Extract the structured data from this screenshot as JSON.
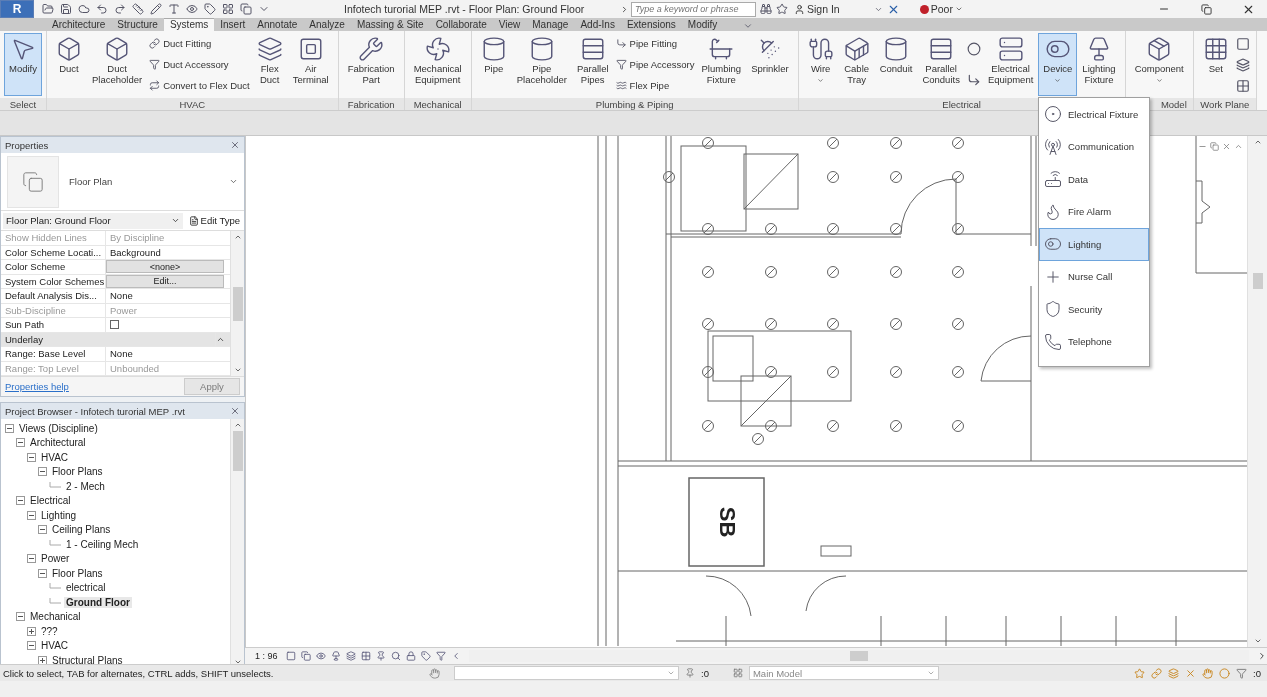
{
  "app_button": {
    "letter": "R"
  },
  "title": "Infotech turorial  MEP .rvt - Floor Plan: Ground Floor",
  "search": {
    "placeholder": "Type a keyword or phrase"
  },
  "sign_in": "Sign In",
  "connection": "Poor",
  "tabs": [
    {
      "label": "Architecture",
      "selected": false
    },
    {
      "label": "Structure",
      "selected": false
    },
    {
      "label": "Systems",
      "selected": true
    },
    {
      "label": "Insert",
      "selected": false
    },
    {
      "label": "Annotate",
      "selected": false
    },
    {
      "label": "Analyze",
      "selected": false
    },
    {
      "label": "Massing & Site",
      "selected": false
    },
    {
      "label": "Collaborate",
      "selected": false
    },
    {
      "label": "View",
      "selected": false
    },
    {
      "label": "Manage",
      "selected": false
    },
    {
      "label": "Add-Ins",
      "selected": false
    },
    {
      "label": "Extensions",
      "selected": false
    },
    {
      "label": "Modify",
      "selected": false
    }
  ],
  "ribbon": [
    {
      "label": "Select",
      "items": [
        {
          "kind": "large",
          "label": "Modify",
          "selected": true,
          "menu": false
        }
      ]
    },
    {
      "label": "HVAC",
      "items": [
        {
          "kind": "large",
          "label": "Duct",
          "selected": false,
          "menu": false
        },
        {
          "kind": "large",
          "label": "Duct\nPlaceholder",
          "selected": false,
          "menu": false
        },
        {
          "kind": "stack",
          "items": [
            "Duct Fitting",
            "Duct Accessory",
            "Convert to Flex Duct"
          ]
        },
        {
          "kind": "large",
          "label": "Flex\nDuct",
          "selected": false,
          "menu": false
        },
        {
          "kind": "large",
          "label": "Air\nTerminal",
          "selected": false,
          "menu": false
        }
      ]
    },
    {
      "label": "Fabrication",
      "items": [
        {
          "kind": "large",
          "label": "Fabrication\nPart",
          "selected": false,
          "menu": false
        }
      ]
    },
    {
      "label": "Mechanical",
      "items": [
        {
          "kind": "large",
          "label": "Mechanical\nEquipment",
          "selected": false,
          "menu": false
        }
      ]
    },
    {
      "label": "Plumbing & Piping",
      "items": [
        {
          "kind": "large",
          "label": "Pipe",
          "selected": false,
          "menu": false
        },
        {
          "kind": "large",
          "label": "Pipe\nPlaceholder",
          "selected": false,
          "menu": false
        },
        {
          "kind": "large",
          "label": "Parallel\nPipes",
          "selected": false,
          "menu": false
        },
        {
          "kind": "stack",
          "items": [
            "Pipe Fitting",
            "Pipe Accessory",
            "Flex Pipe"
          ]
        },
        {
          "kind": "large",
          "label": "Plumbing\nFixture",
          "selected": false,
          "menu": false
        },
        {
          "kind": "large",
          "label": "Sprinkler",
          "selected": false,
          "menu": false
        }
      ]
    },
    {
      "label": "Electrical",
      "items": [
        {
          "kind": "large",
          "label": "Wire",
          "selected": false,
          "menu": true
        },
        {
          "kind": "large",
          "label": "Cable\nTray",
          "selected": false,
          "menu": false
        },
        {
          "kind": "large",
          "label": "Conduit",
          "selected": false,
          "menu": false
        },
        {
          "kind": "large",
          "label": "Parallel\nConduits",
          "selected": false,
          "menu": false
        },
        {
          "kind": "icons"
        },
        {
          "kind": "large",
          "label": "Electrical\nEquipment",
          "selected": false,
          "menu": false
        },
        {
          "kind": "large",
          "label": "Device",
          "selected": true,
          "menu": true
        },
        {
          "kind": "large",
          "label": "Lighting\nFixture",
          "selected": false,
          "menu": false
        }
      ]
    },
    {
      "label": "Model",
      "items": [
        {
          "kind": "large",
          "label": "Component",
          "selected": false,
          "menu": true
        }
      ]
    },
    {
      "label": "Work Plane",
      "items": [
        {
          "kind": "large",
          "label": "Set",
          "selected": false,
          "menu": false
        },
        {
          "kind": "icons"
        }
      ]
    }
  ],
  "device_menu": [
    {
      "label": "Electrical Fixture",
      "selected": false
    },
    {
      "label": "Communication",
      "selected": false
    },
    {
      "label": "Data",
      "selected": false
    },
    {
      "label": "Fire Alarm",
      "selected": false
    },
    {
      "label": "Lighting",
      "selected": true
    },
    {
      "label": "Nurse Call",
      "selected": false
    },
    {
      "label": "Security",
      "selected": false
    },
    {
      "label": "Telephone",
      "selected": false
    }
  ],
  "properties": {
    "title": "Properties",
    "type_name": "Floor Plan",
    "instance": "Floor Plan: Ground Floor",
    "edit_type": "Edit Type",
    "rows": [
      {
        "kind": "text",
        "name": "Show Hidden Lines",
        "value": "By Discipline",
        "disabled": true
      },
      {
        "kind": "text",
        "name": "Color Scheme Locati...",
        "value": "Background",
        "disabled": false
      },
      {
        "kind": "button",
        "name": "Color Scheme",
        "value": "<none>",
        "disabled": false
      },
      {
        "kind": "button",
        "name": "System Color Schemes",
        "value": "Edit...",
        "disabled": false
      },
      {
        "kind": "text",
        "name": "Default Analysis Dis...",
        "value": "None",
        "disabled": false
      },
      {
        "kind": "text",
        "name": "Sub-Discipline",
        "value": "Power",
        "disabled": true
      },
      {
        "kind": "checkbox",
        "name": "Sun Path",
        "checked": false,
        "disabled": false
      },
      {
        "kind": "group",
        "name": "Underlay",
        "expanded": true
      },
      {
        "kind": "text",
        "name": "Range: Base Level",
        "value": "None",
        "disabled": false
      },
      {
        "kind": "text",
        "name": "Range: Top Level",
        "value": "Unbounded",
        "disabled": true
      }
    ],
    "help": "Properties help",
    "apply": {
      "label": "Apply",
      "disabled": true
    }
  },
  "project_browser": {
    "title": "Project Browser - Infotech turorial  MEP .rvt",
    "tree": [
      {
        "label": "Views (Discipline)",
        "expanded": true,
        "selected": false,
        "children": [
          {
            "label": "Architectural",
            "expanded": true,
            "selected": false,
            "children": [
              {
                "label": "HVAC",
                "expanded": true,
                "selected": false,
                "children": [
                  {
                    "label": "Floor Plans",
                    "expanded": true,
                    "selected": false,
                    "children": [
                      {
                        "label": "2 - Mech",
                        "selected": false
                      }
                    ]
                  }
                ]
              }
            ]
          },
          {
            "label": "Electrical",
            "expanded": true,
            "selected": false,
            "children": [
              {
                "label": "Lighting",
                "expanded": true,
                "selected": false,
                "children": [
                  {
                    "label": "Ceiling Plans",
                    "expanded": true,
                    "selected": false,
                    "children": [
                      {
                        "label": "1 - Ceiling Mech",
                        "selected": false
                      }
                    ]
                  }
                ]
              },
              {
                "label": "Power",
                "expanded": true,
                "selected": false,
                "children": [
                  {
                    "label": "Floor Plans",
                    "expanded": true,
                    "selected": false,
                    "children": [
                      {
                        "label": "electrical",
                        "selected": false
                      },
                      {
                        "label": "Ground Floor",
                        "selected": true
                      }
                    ]
                  }
                ]
              }
            ]
          },
          {
            "label": "Mechanical",
            "expanded": true,
            "selected": false,
            "children": [
              {
                "label": "???",
                "expanded": false,
                "selected": false
              },
              {
                "label": "HVAC",
                "expanded": true,
                "selected": false,
                "children": [
                  {
                    "label": "Structural Plans",
                    "expanded": false,
                    "selected": false
                  }
                ]
              }
            ]
          }
        ]
      }
    ]
  },
  "canvas": {
    "room_tag": "SB"
  },
  "view_bar": {
    "scale": "1 : 96"
  },
  "status_bar": {
    "message": "Click to select, TAB for alternates, CTRL adds, SHIFT unselects.",
    "workset_count": ":0",
    "design_option": "Main Model",
    "filter_count": ":0"
  }
}
